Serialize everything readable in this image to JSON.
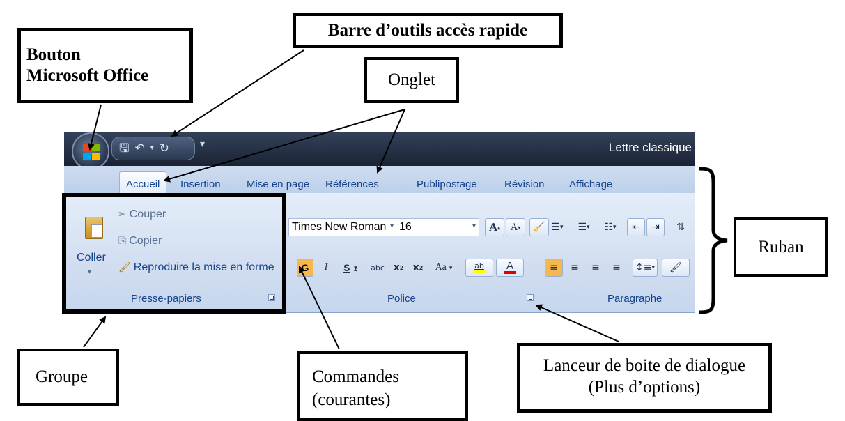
{
  "callouts": {
    "quick_access_toolbar": "Barre d’outils accès rapide",
    "office_button_line1": "Bouton",
    "office_button_line2": "Microsoft Office",
    "tab": "Onglet",
    "ribbon": "Ruban",
    "group": "Groupe",
    "commands_line1": "Commandes",
    "commands_line2": "(courantes)",
    "launcher_line1": "Lanceur de boite de dialogue",
    "launcher_line2": "(Plus d’options)"
  },
  "window": {
    "title": "Lettre classique"
  },
  "quick_access": {
    "save_icon": "save-icon",
    "undo_icon": "undo-icon",
    "redo_icon": "redo-icon",
    "customize_icon": "customize-icon"
  },
  "tabs": [
    "Accueil",
    "Insertion",
    "Mise en page",
    "Références",
    "Publipostage",
    "Révision",
    "Affichage"
  ],
  "clipboard": {
    "paste_label": "Coller",
    "cut_label": "Couper",
    "copy_label": "Copier",
    "format_painter_label": "Reproduire la mise en forme",
    "group_label": "Presse-papiers"
  },
  "font": {
    "font_name": "Times New Roman",
    "font_size": "16",
    "grow": "A",
    "shrink": "A",
    "bold": "G",
    "italic": "I",
    "underline": "S",
    "strikethrough": "abc",
    "subscript": "x",
    "superscript": "x",
    "change_case": "Aa",
    "highlight": "ab",
    "font_color": "A",
    "group_label": "Police"
  },
  "paragraph": {
    "group_label": "Paragraphe"
  },
  "colors": {
    "bold_active": "#f5b74e",
    "font_color_bar": "#e00000",
    "highlight_bar": "#ffff00",
    "tab_text": "#15428b"
  }
}
